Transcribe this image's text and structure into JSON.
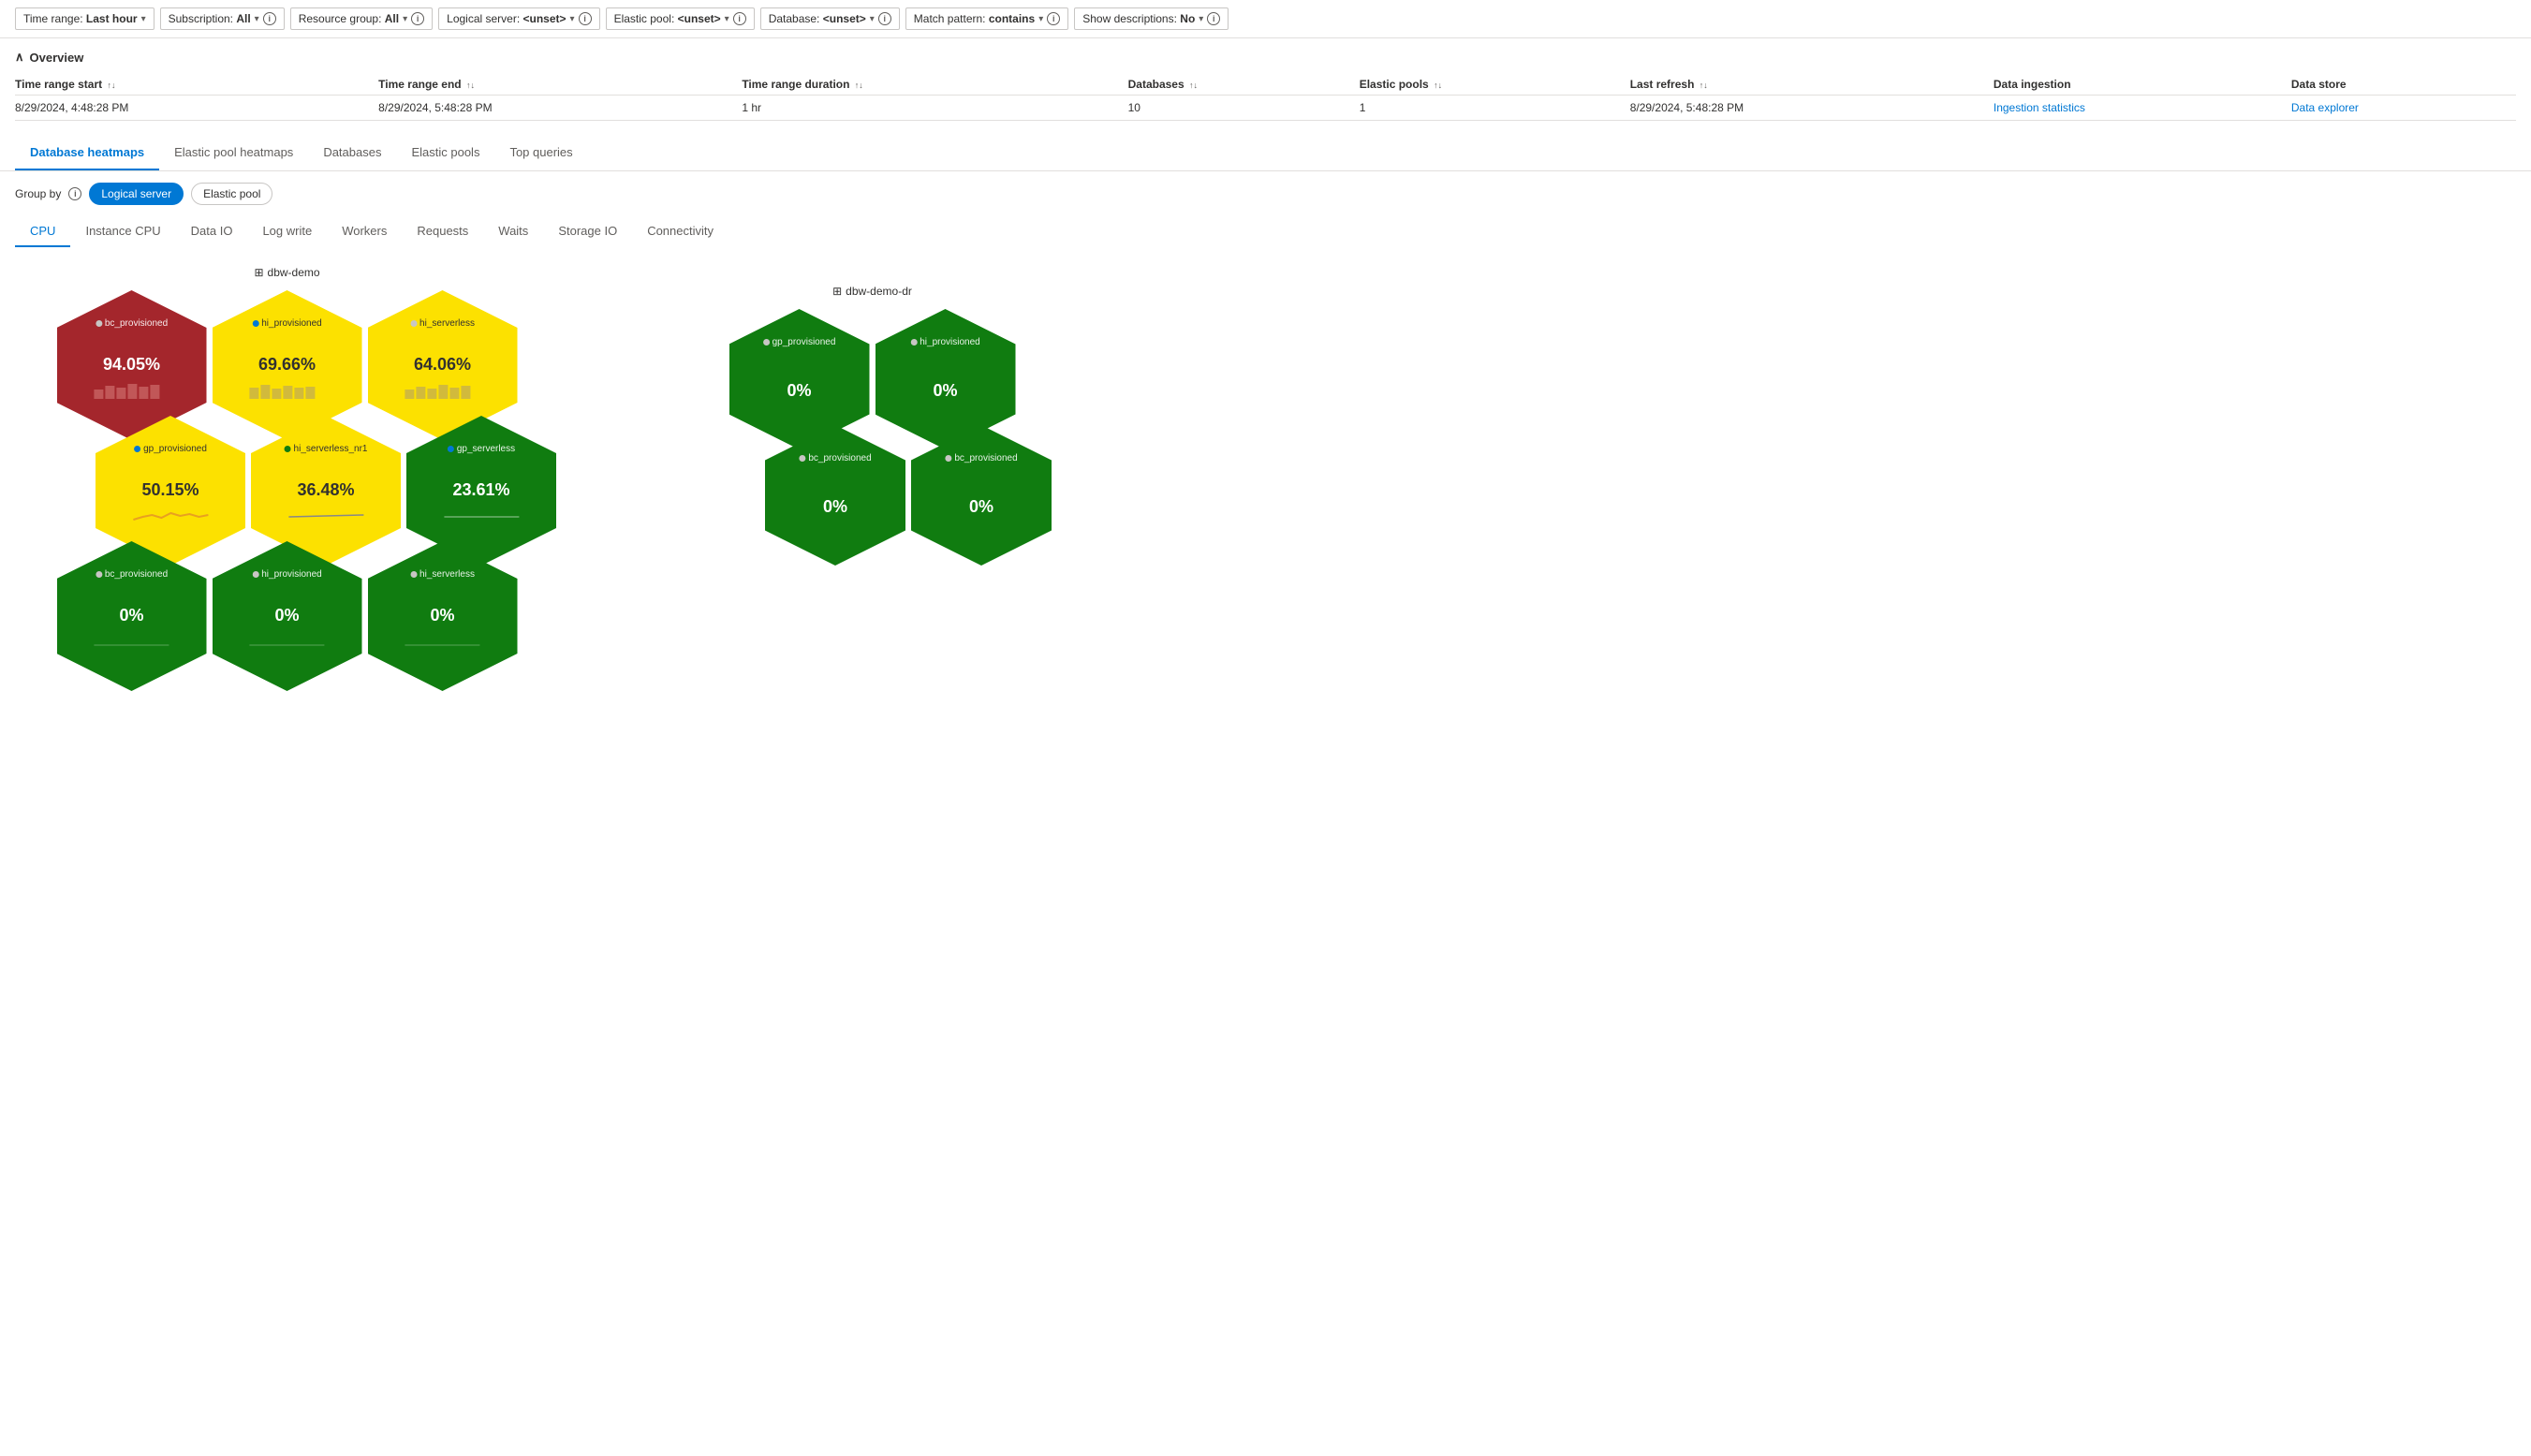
{
  "filterBar": {
    "filters": [
      {
        "id": "time-range",
        "label": "Time range:",
        "value": "Last hour",
        "hasChevron": true,
        "hasInfo": false
      },
      {
        "id": "subscription",
        "label": "Subscription:",
        "value": "All",
        "hasChevron": true,
        "hasInfo": true
      },
      {
        "id": "resource-group",
        "label": "Resource group:",
        "value": "All",
        "hasChevron": true,
        "hasInfo": true
      },
      {
        "id": "logical-server",
        "label": "Logical server:",
        "value": "<unset>",
        "hasChevron": true,
        "hasInfo": true
      },
      {
        "id": "elastic-pool",
        "label": "Elastic pool:",
        "value": "<unset>",
        "hasChevron": true,
        "hasInfo": true
      },
      {
        "id": "database",
        "label": "Database:",
        "value": "<unset>",
        "hasChevron": true,
        "hasInfo": true
      },
      {
        "id": "match-pattern",
        "label": "Match pattern:",
        "value": "contains",
        "hasChevron": true,
        "hasInfo": true
      },
      {
        "id": "show-descriptions",
        "label": "Show descriptions:",
        "value": "No",
        "hasChevron": true,
        "hasInfo": true
      }
    ]
  },
  "overview": {
    "title": "Overview",
    "table": {
      "columns": [
        {
          "id": "time-start",
          "label": "Time range start",
          "sortable": true
        },
        {
          "id": "time-end",
          "label": "Time range end",
          "sortable": true
        },
        {
          "id": "duration",
          "label": "Time range duration",
          "sortable": true
        },
        {
          "id": "databases",
          "label": "Databases",
          "sortable": true
        },
        {
          "id": "elastic-pools",
          "label": "Elastic pools",
          "sortable": true
        },
        {
          "id": "last-refresh",
          "label": "Last refresh",
          "sortable": true
        },
        {
          "id": "data-ingestion",
          "label": "Data ingestion",
          "sortable": false
        },
        {
          "id": "data-store",
          "label": "Data store",
          "sortable": false
        }
      ],
      "rows": [
        {
          "timeStart": "8/29/2024, 4:48:28 PM",
          "timeEnd": "8/29/2024, 5:48:28 PM",
          "duration": "1 hr",
          "databases": "10",
          "elasticPools": "1",
          "lastRefresh": "8/29/2024, 5:48:28 PM",
          "dataIngestion": "Ingestion statistics",
          "dataIngestionLink": true,
          "dataStore": "Data explorer",
          "dataStoreLink": true
        }
      ]
    }
  },
  "mainTabs": [
    {
      "id": "database-heatmaps",
      "label": "Database heatmaps",
      "active": true
    },
    {
      "id": "elastic-pool-heatmaps",
      "label": "Elastic pool heatmaps",
      "active": false
    },
    {
      "id": "databases",
      "label": "Databases",
      "active": false
    },
    {
      "id": "elastic-pools",
      "label": "Elastic pools",
      "active": false
    },
    {
      "id": "top-queries",
      "label": "Top queries",
      "active": false
    }
  ],
  "groupBy": {
    "label": "Group by",
    "options": [
      {
        "id": "logical-server",
        "label": "Logical server",
        "active": true
      },
      {
        "id": "elastic-pool",
        "label": "Elastic pool",
        "active": false
      }
    ]
  },
  "subTabs": [
    {
      "id": "cpu",
      "label": "CPU",
      "active": true
    },
    {
      "id": "instance-cpu",
      "label": "Instance CPU",
      "active": false
    },
    {
      "id": "data-io",
      "label": "Data IO",
      "active": false
    },
    {
      "id": "log-write",
      "label": "Log write",
      "active": false
    },
    {
      "id": "workers",
      "label": "Workers",
      "active": false
    },
    {
      "id": "requests",
      "label": "Requests",
      "active": false
    },
    {
      "id": "waits",
      "label": "Waits",
      "active": false
    },
    {
      "id": "storage-io",
      "label": "Storage IO",
      "active": false
    },
    {
      "id": "connectivity",
      "label": "Connectivity",
      "active": false
    }
  ],
  "servers": [
    {
      "id": "dbw-demo",
      "label": "dbw-demo",
      "hexRows": [
        [
          {
            "id": "bc_provisioned_1",
            "name": "bc_provisioned",
            "value": "94.05%",
            "color": "red",
            "dotColor": "#c8c8c8",
            "sparkType": "bar"
          },
          {
            "id": "hi_provisioned_1",
            "name": "hi_provisioned",
            "value": "69.66%",
            "color": "yellow",
            "dotColor": "#0078d4",
            "sparkType": "bar"
          },
          {
            "id": "hi_serverless_1",
            "name": "hi_serverless",
            "value": "64.06%",
            "color": "yellow",
            "dotColor": "#c8c8c8",
            "sparkType": "bar"
          }
        ],
        [
          {
            "id": "gp_provisioned_1",
            "name": "gp_provisioned",
            "value": "50.15%",
            "color": "yellow",
            "dotColor": "#0078d4",
            "sparkType": "wave"
          },
          {
            "id": "hi_serverless_nr1",
            "name": "hi_serverless_nr1",
            "value": "36.48%",
            "color": "yellow",
            "dotColor": "#107c10",
            "sparkType": "line"
          },
          {
            "id": "gp_serverless_1",
            "name": "gp_serverless",
            "value": "23.61%",
            "color": "green",
            "dotColor": "#0078d4",
            "sparkType": "flat"
          }
        ],
        [
          {
            "id": "bc_provisioned_2",
            "name": "bc_provisioned",
            "value": "0%",
            "color": "green",
            "dotColor": "#c8c8c8",
            "sparkType": "flat"
          },
          {
            "id": "hi_provisioned_2",
            "name": "hi_provisioned",
            "value": "0%",
            "color": "green",
            "dotColor": "#c8c8c8",
            "sparkType": "flat"
          },
          {
            "id": "hi_serverless_2",
            "name": "hi_serverless",
            "value": "0%",
            "color": "green",
            "dotColor": "#c8c8c8",
            "sparkType": "flat"
          }
        ]
      ]
    },
    {
      "id": "dbw-demo-dr",
      "label": "dbw-demo-dr",
      "hexRows": [
        [
          {
            "id": "gp_provisioned_dr1",
            "name": "gp_provisioned",
            "value": "0%",
            "color": "green",
            "dotColor": "#c8c8c8",
            "sparkType": "flat"
          },
          {
            "id": "hi_provisioned_dr1",
            "name": "hi_provisioned",
            "value": "0%",
            "color": "green",
            "dotColor": "#c8c8c8",
            "sparkType": "flat"
          }
        ],
        [
          {
            "id": "bc_provisioned_dr1",
            "name": "bc_provisioned",
            "value": "0%",
            "color": "green",
            "dotColor": "#c8c8c8",
            "sparkType": "flat"
          },
          {
            "id": "bc_provisioned_dr2",
            "name": "bc_provisioned",
            "value": "0%",
            "color": "green",
            "dotColor": "#c8c8c8",
            "sparkType": "flat"
          }
        ]
      ]
    }
  ]
}
